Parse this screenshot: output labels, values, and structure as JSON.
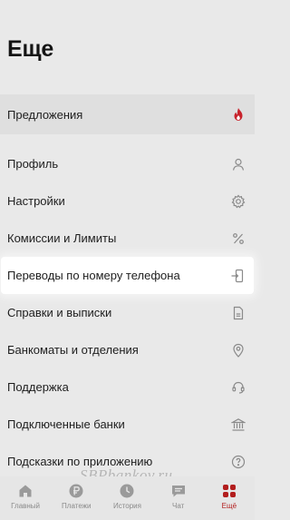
{
  "page": {
    "title": "Еще"
  },
  "promo": {
    "label": "Предложения",
    "icon": "fire-icon",
    "icon_color": "#c8232c"
  },
  "menu": {
    "items": [
      {
        "label": "Профиль",
        "icon": "person-icon"
      },
      {
        "label": "Настройки",
        "icon": "gear-icon"
      },
      {
        "label": "Комиссии и Лимиты",
        "icon": "percent-icon"
      },
      {
        "label": "Переводы по номеру телефона",
        "icon": "phone-transfer-icon",
        "highlighted": true
      },
      {
        "label": "Справки и выписки",
        "icon": "document-icon"
      },
      {
        "label": "Банкоматы и отделения",
        "icon": "location-pin-icon"
      },
      {
        "label": "Поддержка",
        "icon": "support-icon"
      },
      {
        "label": "Подключенные банки",
        "icon": "bank-icon"
      },
      {
        "label": "Подсказки по приложению",
        "icon": "question-icon"
      }
    ]
  },
  "bottom_nav": {
    "items": [
      {
        "label": "Главный",
        "icon": "home-icon"
      },
      {
        "label": "Платежи",
        "icon": "ruble-icon"
      },
      {
        "label": "История",
        "icon": "clock-icon"
      },
      {
        "label": "Чат",
        "icon": "chat-icon"
      },
      {
        "label": "Ещё",
        "icon": "grid-icon",
        "active": true
      }
    ],
    "active_color": "#b21d1d"
  },
  "watermark": "SBPbankov.ru"
}
